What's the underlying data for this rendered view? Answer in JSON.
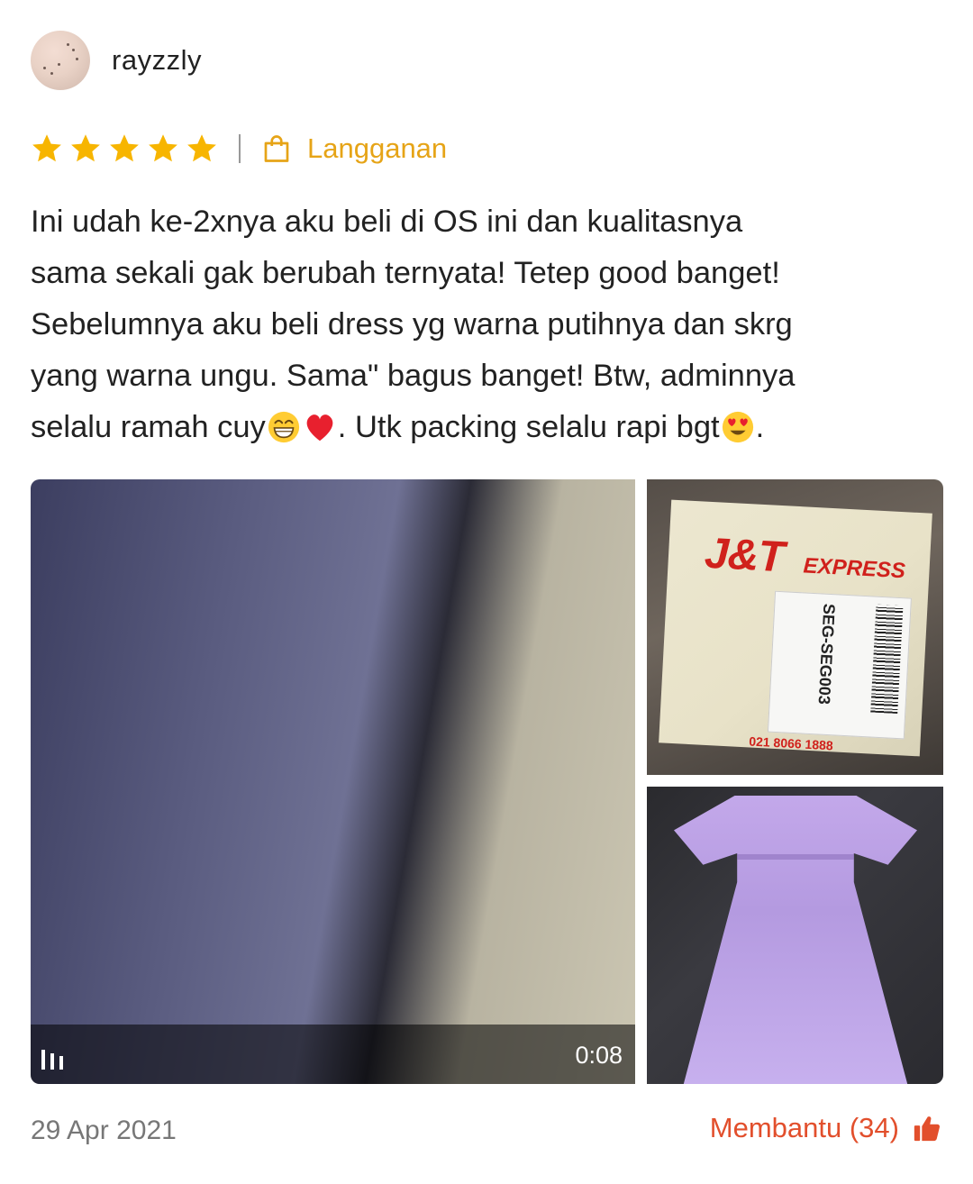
{
  "review": {
    "username": "rayzzly",
    "rating": 5,
    "rating_max": 5,
    "variant_label": "Langganan",
    "text_lines": [
      "Ini udah ke-2xnya aku beli di OS ini dan kualitasnya",
      "sama sekali gak berubah ternyata! Tetep good banget!",
      "Sebelumnya aku beli dress yg warna putihnya dan skrg",
      "yang warna ungu. Sama\" bagus banget!  Btw, adminnya"
    ],
    "text_line5_part1": "selalu ramah cuy",
    "text_line5_part2": ". Utk packing selalu rapi bgt",
    "text_line5_part3": ".",
    "emojis": [
      "grin-emoji",
      "heart-emoji",
      "heart-eyes-emoji"
    ],
    "video_duration": "0:08",
    "parcel_brand": "J&T",
    "parcel_brand_suffix": "EXPRESS",
    "parcel_code": "SEG-SEG003",
    "parcel_phone": "021 8066 1888",
    "date": "29 Apr 2021",
    "helpful_label": "Membantu (34)"
  },
  "colors": {
    "star": "#f7b500",
    "variant": "#e6a417",
    "helpful": "#e24f2c"
  }
}
